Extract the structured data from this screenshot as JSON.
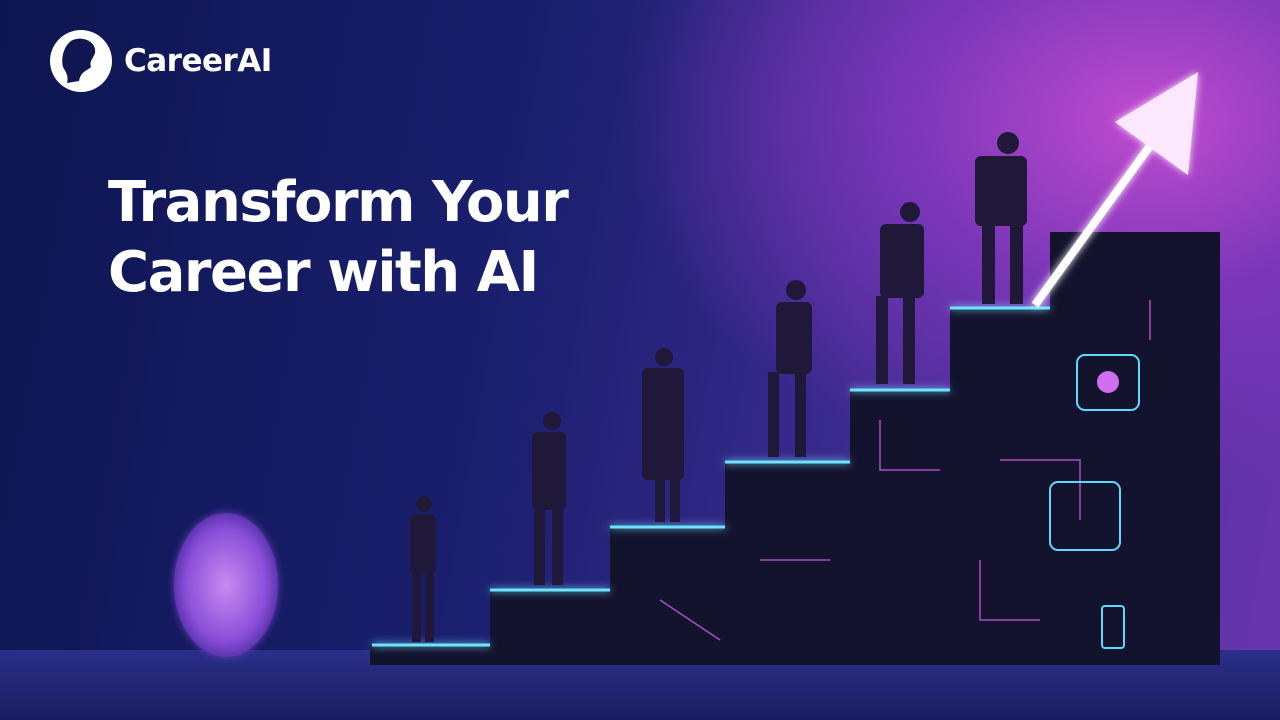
{
  "brand": {
    "name": "CareerAI",
    "logo_icon": "head-silhouette-icon"
  },
  "hero": {
    "headline_line1": "Transform Your",
    "headline_line2": "Career with AI"
  },
  "colors": {
    "accent_pink": "#f06ae8",
    "accent_blue": "#4fd2ff",
    "bg_dark": "#0d1550"
  }
}
